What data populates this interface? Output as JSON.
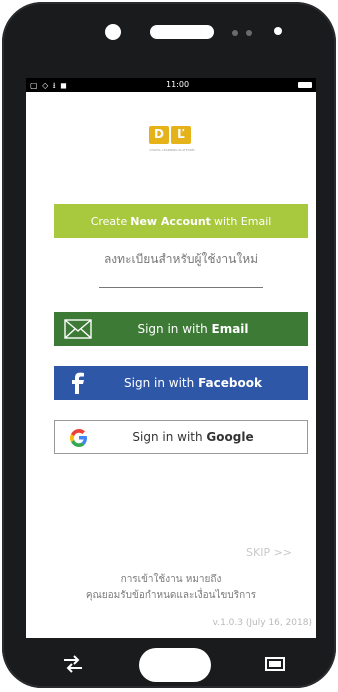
{
  "statusbar": {
    "left_icons": "▢ ◇ ⭳ ◼",
    "time": "11:00"
  },
  "logo": {
    "letters": [
      "D",
      "Ľ"
    ],
    "subtitle": "DIGITAL LEARNING PLATFORM"
  },
  "buttons": {
    "create_account": {
      "prefix": "Create",
      "bold": "New Account",
      "suffix": "with Email"
    },
    "register_thai": "ลงทะเบียนสำหรับผู้ใช้งานใหม่",
    "email": {
      "prefix": "Sign in with",
      "bold": "Email"
    },
    "facebook": {
      "prefix": "Sign in with",
      "bold": "Facebook"
    },
    "google": {
      "prefix": "Sign in with",
      "bold": "Google"
    }
  },
  "footer": {
    "skip": "SKIP >>",
    "terms_line1": "การเข้าใช้งาน หมายถึง",
    "terms_line2": "คุณยอมรับข้อกำหนดและเงื่อนไขบริการ",
    "version": "v.1.0.3 (July 16, 2018)"
  },
  "icons": {
    "email": "envelope-icon",
    "facebook": "facebook-icon",
    "google": "google-icon",
    "back": "back-icon",
    "recent": "recent-apps-icon"
  },
  "colors": {
    "create_button": "#a8c83d",
    "email_button": "#3d7a36",
    "facebook_button": "#2f57a7",
    "logo": "#e6b21a"
  }
}
